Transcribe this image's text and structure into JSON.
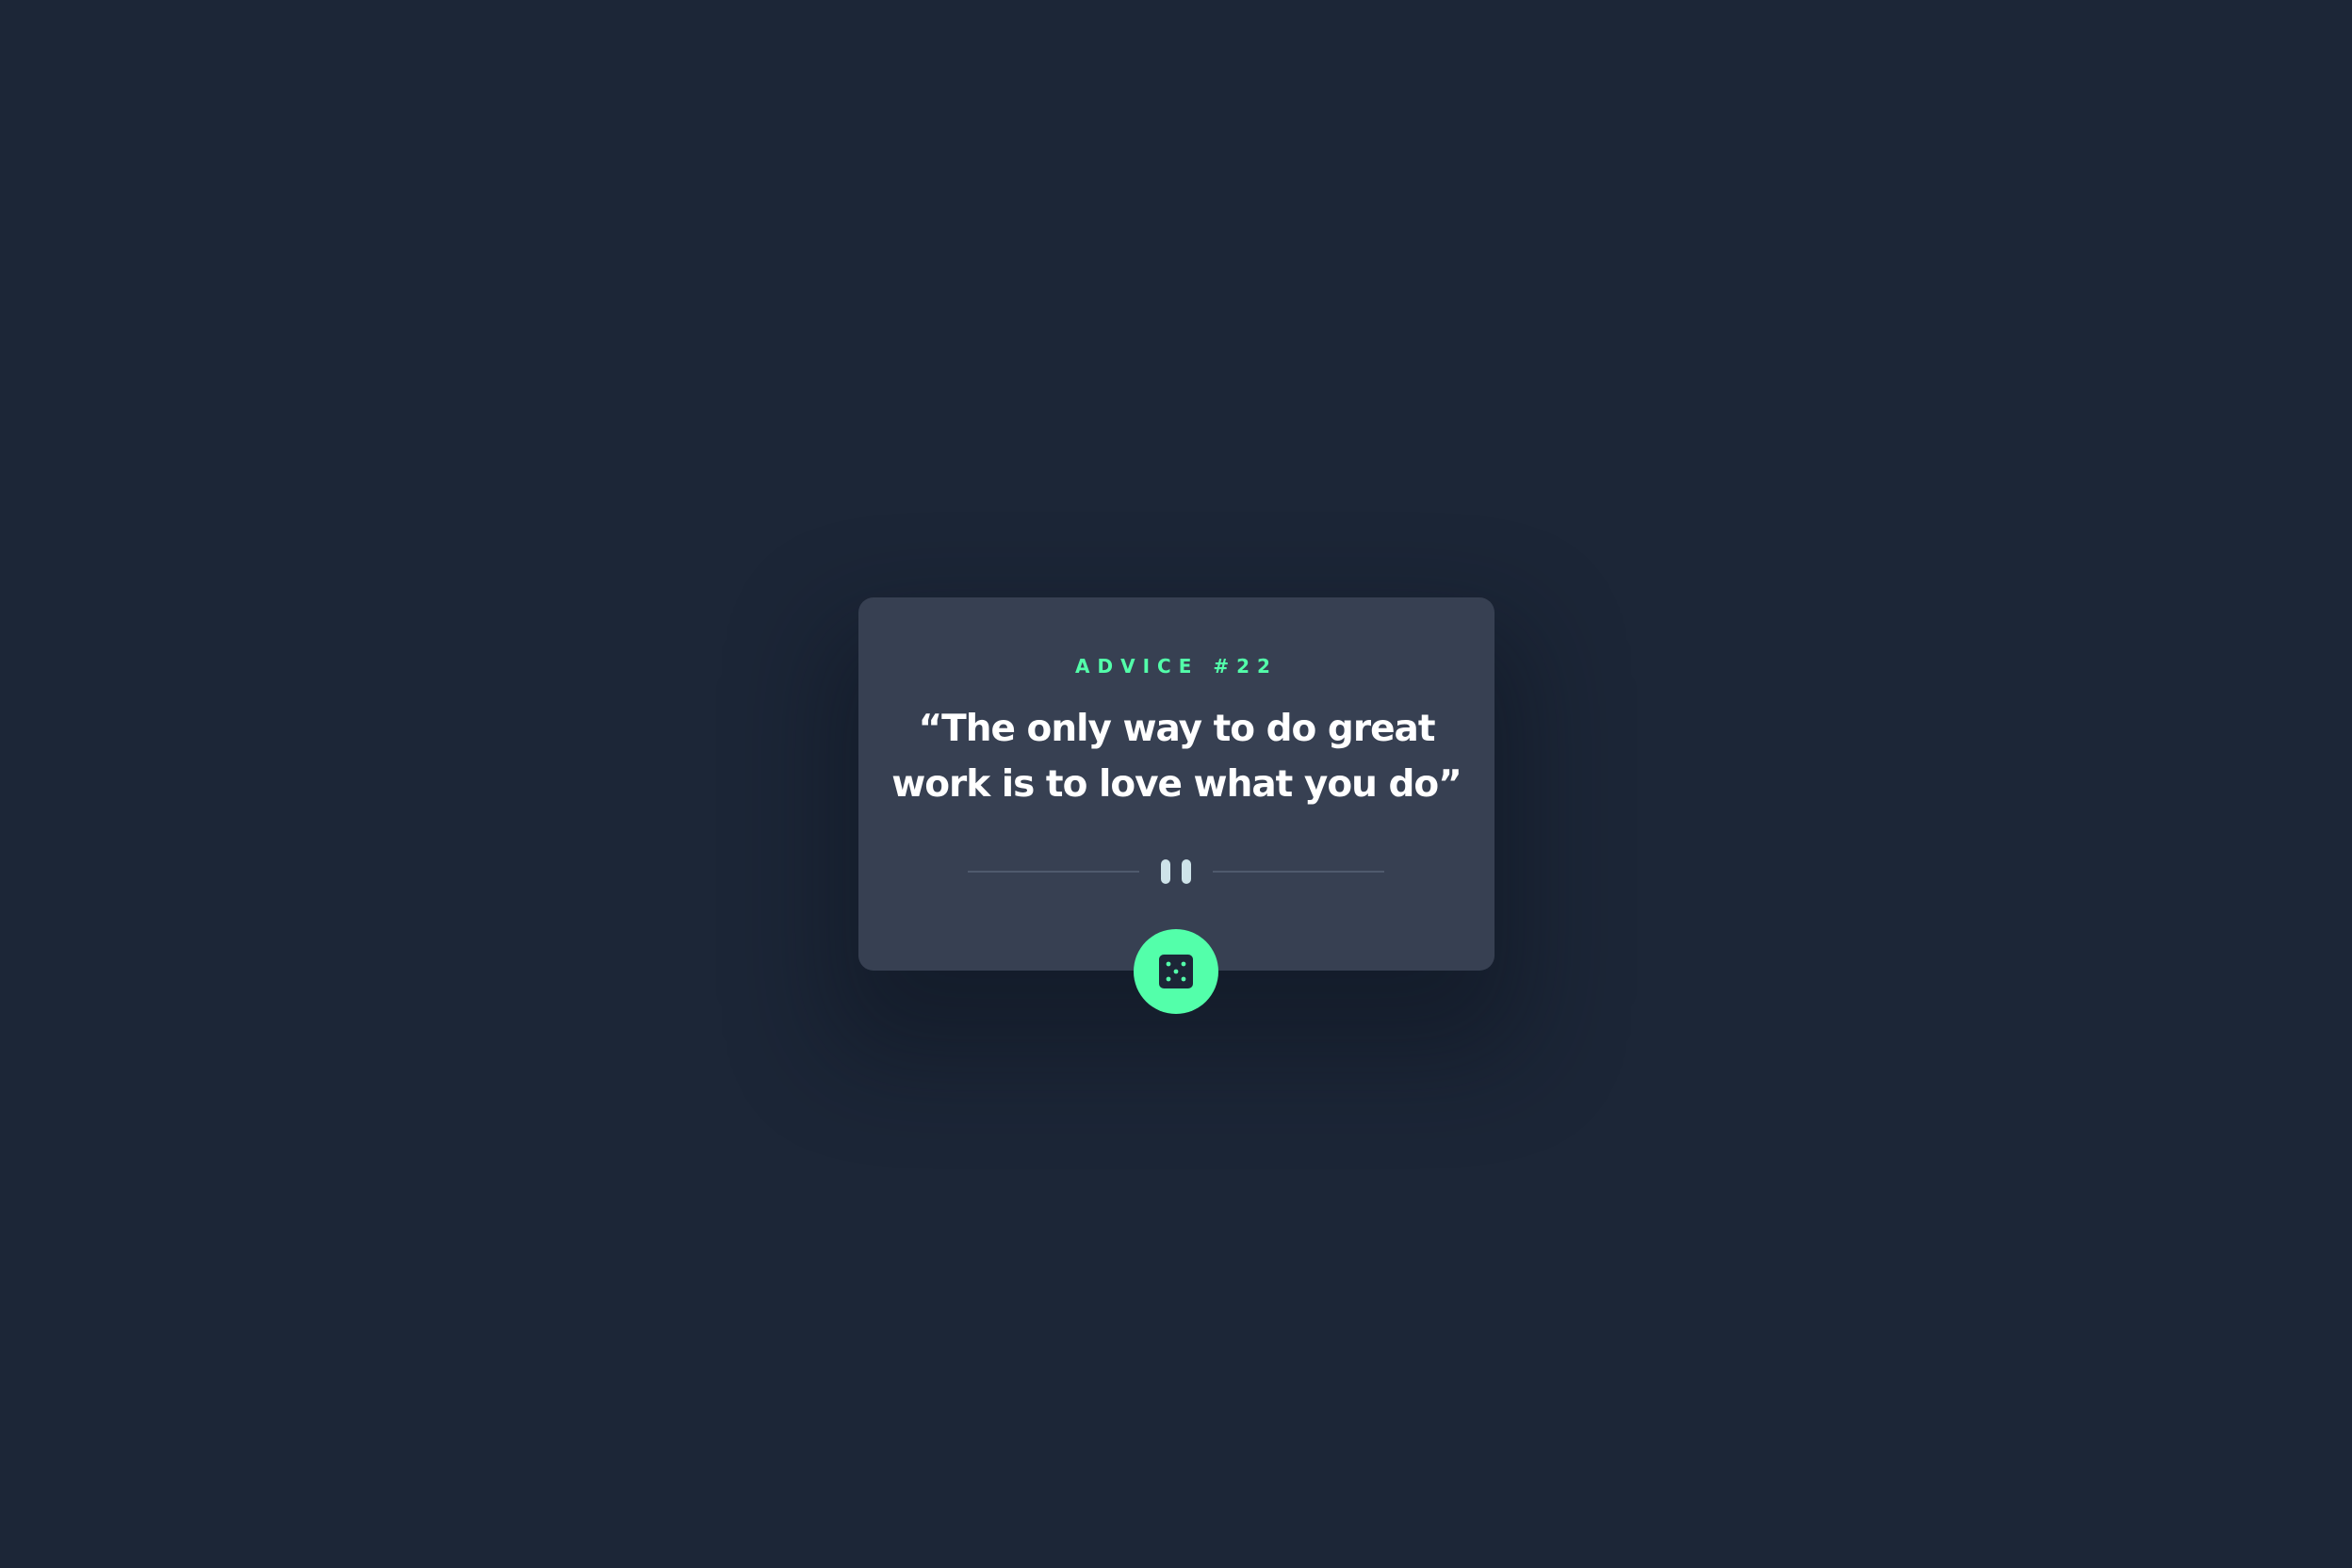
{
  "advice": {
    "label": "ADVICE #22",
    "quote": "“The only way to do great work is to love what you do”"
  },
  "controls": {
    "dice_icon": "dice-icon",
    "divider_icon": "pause-icon"
  },
  "colors": {
    "background": "#1c2637",
    "card": "#374052",
    "accent": "#53ffaa",
    "text": "#ffffff",
    "divider": "#4f5a6d"
  }
}
